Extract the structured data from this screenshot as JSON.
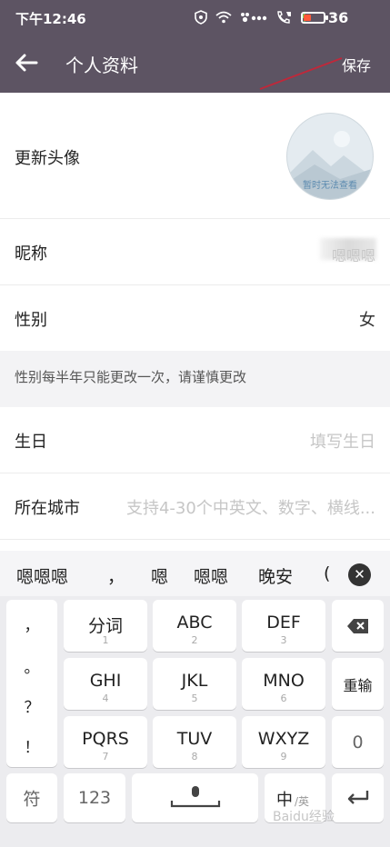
{
  "status_bar": {
    "time": "下午12:46",
    "battery": "36",
    "battery_level": 0.36,
    "battery_color": "#ff5a3a"
  },
  "app_bar": {
    "title": "个人资料",
    "save_label": "保存",
    "bg_color": "#5d5463"
  },
  "form": {
    "avatar": {
      "label": "更新头像",
      "caption": "暂时无法查看"
    },
    "nickname": {
      "label": "昵称",
      "value": "嗯嗯嗯"
    },
    "gender": {
      "label": "性别",
      "value": "女"
    },
    "notice": "性别每半年只能更改一次，请谨慎更改",
    "birthday": {
      "label": "生日",
      "placeholder": "填写生日"
    },
    "city": {
      "label": "所在城市",
      "placeholder": "支持4-30个中英文、数字、横线..."
    }
  },
  "keyboard": {
    "candidates": [
      "嗯嗯嗯",
      "，",
      "嗯",
      "嗯嗯",
      "晚安",
      "("
    ],
    "punctuation": [
      "，",
      "。",
      "？",
      "！"
    ],
    "rows": [
      [
        {
          "main": "分词",
          "sub": "1"
        },
        {
          "main": "ABC",
          "sub": "2"
        },
        {
          "main": "DEF",
          "sub": "3"
        }
      ],
      [
        {
          "main": "GHI",
          "sub": "4"
        },
        {
          "main": "JKL",
          "sub": "5"
        },
        {
          "main": "MNO",
          "sub": "6"
        }
      ],
      [
        {
          "main": "PQRS",
          "sub": "7"
        },
        {
          "main": "TUV",
          "sub": "8"
        },
        {
          "main": "WXYZ",
          "sub": "9"
        }
      ]
    ],
    "reinput": "重输",
    "zero": "0",
    "symbol": "符",
    "num": "123",
    "lang_main": "中",
    "lang_sub": "/英"
  },
  "watermark": "Baidu经验"
}
